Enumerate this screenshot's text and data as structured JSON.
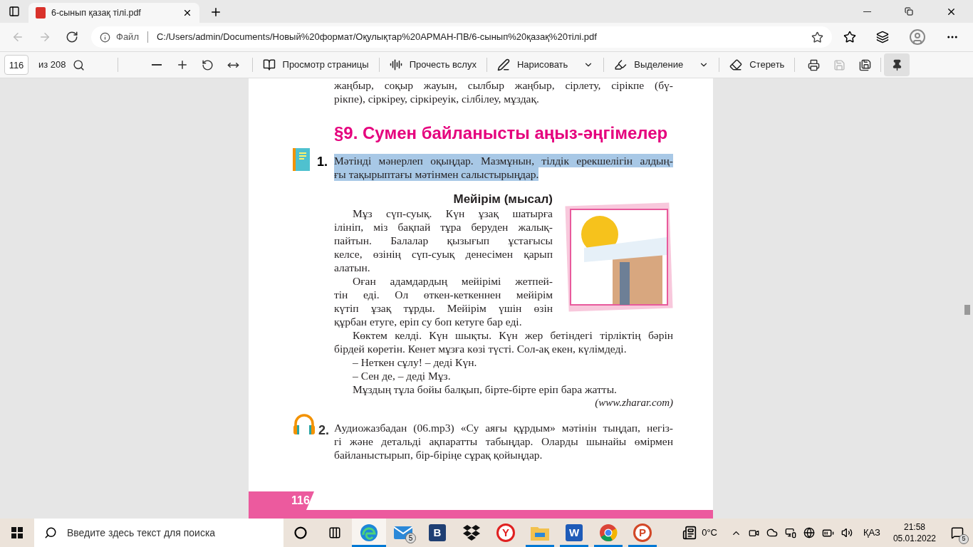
{
  "browser_tab": {
    "title": "6-сынып қазақ тілі.pdf",
    "selected": true
  },
  "address_bar": {
    "label": "Файл",
    "url": "C:/Users/admin/Documents/Новый%20формат/Оқулықтар%20АРМАН-ПВ/6-сынып%20қазақ%20тілі.pdf"
  },
  "pdf_toolbar": {
    "page": "116",
    "page_total": "из 208",
    "pinned": true,
    "buttons": [
      {
        "kind": "view",
        "label": "Просмотр страницы",
        "menu": false
      },
      {
        "kind": "read",
        "label": "Прочесть вслух",
        "menu": false
      },
      {
        "kind": "draw",
        "label": "Нарисовать",
        "menu": true
      },
      {
        "kind": "highlight",
        "label": "Выделение",
        "menu": true
      },
      {
        "kind": "erase",
        "label": "Стереть",
        "menu": false
      }
    ]
  },
  "document": {
    "top_lines": [
      "жаңбыр, соқыр жауын, сылбыр жаңбыр, сірлету, сірікпе (бү-",
      "рікпе), сіркіреу, сіркіреуік, сілбілеу, мұздақ."
    ],
    "heading": "§9. Сумен байланысты аңыз-әңгімелер",
    "tasks": [
      {
        "kind": "book",
        "number": "1.",
        "selected": true,
        "lines": [
          "Мәтінді мәнерлеп оқыңдар. Мазмұнын, тілдік ерекшелігін алдың-",
          "ғы тақырыптағы мәтінмен салыстырыңдар."
        ]
      },
      {
        "kind": "audio",
        "number": "2.",
        "selected": false,
        "lines": [
          "Аудиожазбадан (06.mp3) «Су аяғы құрдым» мәтінін тыңдап, негіз-",
          "гі және детальді ақпаратты табыңдар. Оларды шынайы өмірмен",
          "байланыстырып, бір-біріңе сұрақ қойыңдар."
        ]
      }
    ],
    "story": {
      "title": "Мейірім (мысал)",
      "beside_image": [
        {
          "lines": [
            "Мұз сүп-суық. Күн ұзақ шатырға",
            "ілініп, міз бақпай тұра беруден жалық-",
            "пайтын. Балалар қызығып ұстағысы",
            "келсе, өзінің сүп-суық денесімен қарып",
            "алатын."
          ]
        },
        {
          "lines": [
            "Оған адамдардың мейірімі жетпей-",
            "тін еді. Ол өткен-кеткеннен мейірім",
            "күтіп ұзақ тұрды. Мейірім үшін өзін",
            "құрбан етуге, еріп су боп кетуге бар еді."
          ]
        }
      ],
      "below": [
        {
          "lines": [
            "Көктем келді. Күн шықты. Күн жер бетіндегі тірліктің бәрін",
            "бірдей көретін. Кенет мұзға көзі түсті. Сол-ақ екен, күлімдеді."
          ]
        },
        {
          "lines": [
            "– Неткен сұлу! – деді Күн."
          ]
        },
        {
          "lines": [
            "– Сен де, – деді Мұз."
          ]
        },
        {
          "lines": [
            "Мұздың тұла бойы балқып, бірте-бірте еріп бара жатты."
          ]
        }
      ],
      "source": "(www.zharar.com)"
    },
    "page_number": "116"
  },
  "taskbar": {
    "search_placeholder": "Введите здесь текст для поиска",
    "apps": [
      {
        "kind": "swirl",
        "running": true,
        "selected": true
      },
      {
        "kind": "envelope",
        "running": false,
        "selected": false,
        "badge": "5"
      },
      {
        "kind": "tile",
        "glyph": "B",
        "color": "#1f3f73",
        "running": false,
        "selected": false
      },
      {
        "kind": "boxes",
        "running": false,
        "selected": false
      },
      {
        "kind": "round",
        "glyph": "Y",
        "color": "#e02020",
        "running": false,
        "selected": false
      },
      {
        "kind": "folder",
        "running": true,
        "selected": false
      },
      {
        "kind": "tile",
        "glyph": "W",
        "color": "#1e5bb8",
        "running": true,
        "selected": false
      },
      {
        "kind": "chrome",
        "running": true,
        "selected": false
      },
      {
        "kind": "round",
        "glyph": "P",
        "color": "#d24726",
        "running": true,
        "selected": false
      }
    ],
    "temperature": "0°C",
    "language": "ҚАЗ",
    "time": "21:58",
    "date": "05.01.2022",
    "notifications": "5"
  }
}
